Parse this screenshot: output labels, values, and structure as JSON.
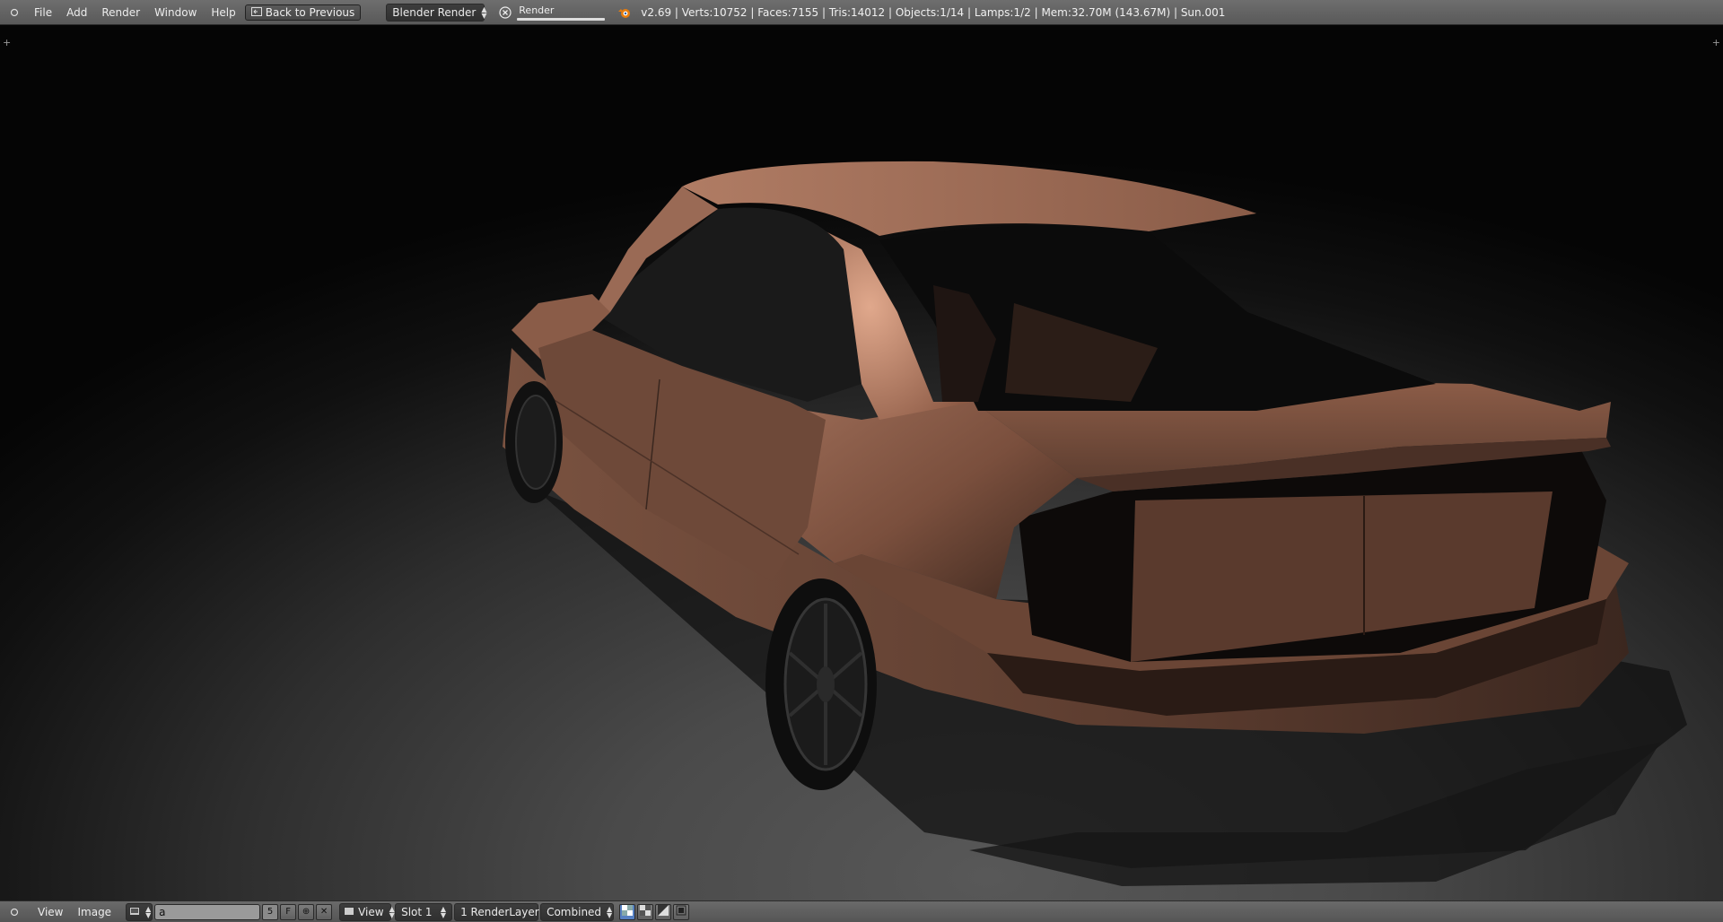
{
  "topbar": {
    "menu": [
      "File",
      "Add",
      "Render",
      "Window",
      "Help"
    ],
    "back_button": "Back to Previous",
    "engine": "Blender Render",
    "scene_field_label": "Render",
    "status": "v2.69 | Verts:10752 | Faces:7155 | Tris:14012 | Objects:1/14 | Lamps:1/2 | Mem:32.70M (143.67M) | Sun.001"
  },
  "bottombar": {
    "menu": [
      "View",
      "Image"
    ],
    "image_name": "a",
    "users_count": "5",
    "fake_user": "F",
    "view_dropdown": "View",
    "slot_dropdown": "Slot 1",
    "layer_dropdown": "1 RenderLayer",
    "pass_dropdown": "Combined"
  },
  "viewport": {
    "content": "render-result"
  },
  "colors": {
    "car_body": "#8a5a45",
    "header_bg": "#666666"
  }
}
